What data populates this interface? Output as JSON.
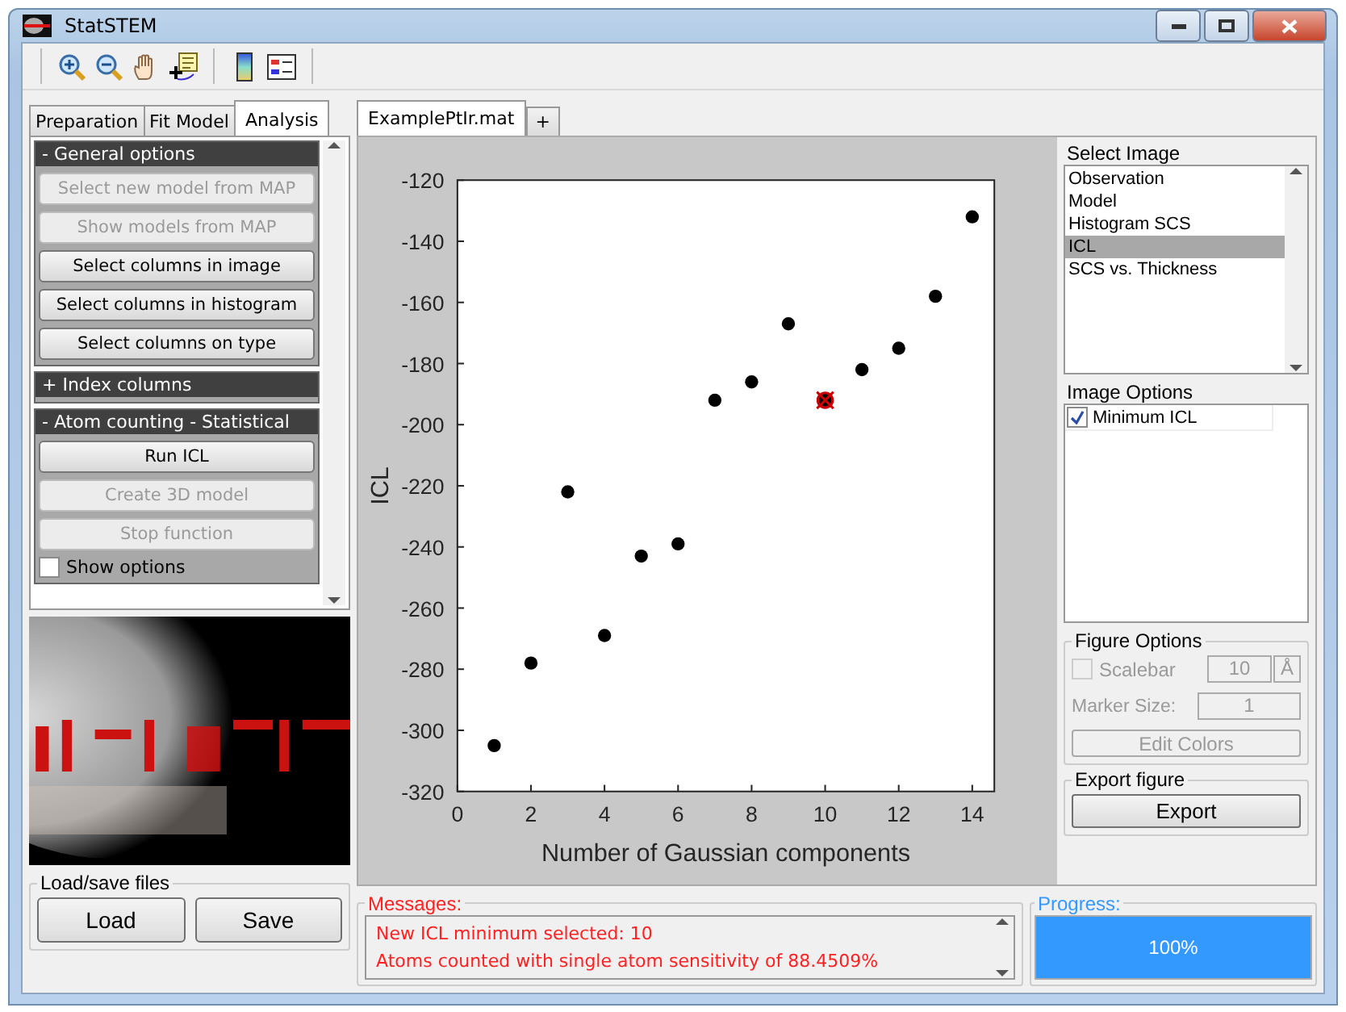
{
  "window": {
    "title": "StatSTEM"
  },
  "left_tabs": [
    {
      "label": "Preparation",
      "selected": false
    },
    {
      "label": "Fit Model",
      "selected": false
    },
    {
      "label": "Analysis",
      "selected": true
    }
  ],
  "option_panels": [
    {
      "title": "- General options",
      "buttons": [
        {
          "label": "Select new model from MAP",
          "disabled": true
        },
        {
          "label": "Show models from MAP",
          "disabled": true
        },
        {
          "label": "Select columns in image",
          "disabled": false
        },
        {
          "label": "Select columns in histogram",
          "disabled": false
        },
        {
          "label": "Select columns on type",
          "disabled": false
        }
      ]
    },
    {
      "title": "+ Index columns"
    },
    {
      "title": "- Atom counting - Statistical",
      "buttons": [
        {
          "label": "Run ICL",
          "disabled": false
        },
        {
          "label": "Create 3D model",
          "disabled": true
        },
        {
          "label": "Stop function",
          "disabled": true
        }
      ],
      "checkboxes": [
        {
          "label": "Show options",
          "checked": false
        }
      ]
    }
  ],
  "load_save": {
    "title": "Load/save files",
    "buttons": [
      "Load",
      "Save"
    ]
  },
  "file_tabs": [
    {
      "label": "ExamplePtIr.mat",
      "selected": true
    },
    {
      "label": "+",
      "selected": false
    }
  ],
  "plot": {
    "chart_data": {
      "type": "scatter",
      "xlabel": "Number of Gaussian components",
      "ylabel": "ICL",
      "x": [
        1,
        2,
        3,
        4,
        5,
        6,
        7,
        8,
        9,
        10,
        11,
        12,
        13,
        14
      ],
      "series": [
        {
          "color": "#000000",
          "values": [
            -305,
            -278,
            -222,
            -269,
            -243,
            -239,
            -192,
            -186,
            -167,
            -192,
            -182,
            -175,
            -158,
            -132
          ]
        },
        {
          "color": "#cc0000",
          "values": [
            null,
            null,
            null,
            null,
            null,
            null,
            null,
            null,
            null,
            -192,
            null,
            null,
            null,
            null
          ]
        }
      ],
      "xlim": [
        0,
        14.6
      ],
      "ylim": [
        -320,
        -120
      ],
      "xticks": [
        0,
        2,
        4,
        6,
        8,
        10,
        12,
        14
      ],
      "yticks": [
        -320,
        -300,
        -280,
        -260,
        -240,
        -220,
        -200,
        -180,
        -160,
        -140,
        -120
      ]
    }
  },
  "select_image": {
    "title": "Select Image",
    "items": [
      {
        "label": "Observation",
        "selected": false
      },
      {
        "label": "Model",
        "selected": false
      },
      {
        "label": "Histogram SCS",
        "selected": false
      },
      {
        "label": "ICL",
        "selected": true
      },
      {
        "label": "SCS vs. Thickness",
        "selected": false
      }
    ]
  },
  "image_options": {
    "title": "Image Options",
    "checkboxes": [
      {
        "label": "Minimum ICL",
        "checked": true
      }
    ]
  },
  "figure_options": {
    "title": "Figure Options",
    "disabled": true,
    "scalebar": {
      "label": "Scalebar",
      "checked": false,
      "value": "10",
      "unit": "Å"
    },
    "marker_size": {
      "label": "Marker Size:",
      "value": "1"
    },
    "edit_colors": "Edit Colors"
  },
  "export": {
    "title": "Export figure",
    "button": "Export"
  },
  "messages": {
    "title": "Messages:",
    "lines": [
      "New ICL minimum selected: 10",
      "Atoms counted with single atom sensitivity of 88.4509%"
    ]
  },
  "progress": {
    "title": "Progress:",
    "level": 1,
    "text": "100%"
  }
}
